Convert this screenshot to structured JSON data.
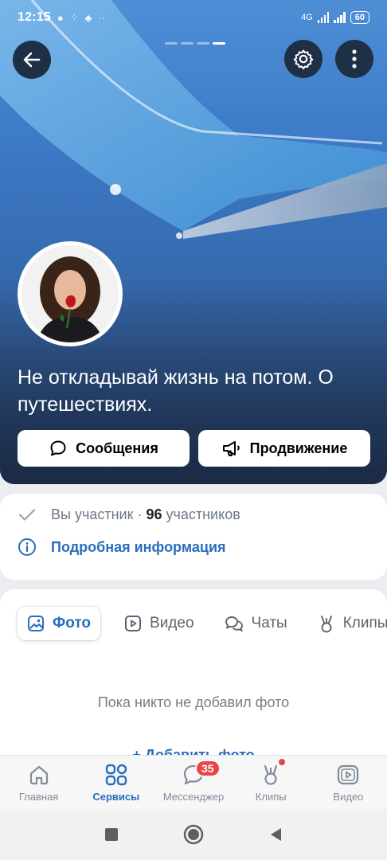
{
  "status": {
    "time": "12:15",
    "network": "4G",
    "battery": "60"
  },
  "hero": {
    "title": "Не откладывай жизнь на потом. О путешествиях.",
    "pages": 4,
    "active_page": 4
  },
  "actions": [
    {
      "label": "Сообщения",
      "icon": "chat-bubble-icon"
    },
    {
      "label": "Продвижение",
      "icon": "megaphone-icon"
    }
  ],
  "info": {
    "member_text": "Вы участник · ",
    "member_count": "96",
    "member_suffix": " участников",
    "details_link": "Подробная информация"
  },
  "tabs": [
    {
      "label": "Фото",
      "active": true
    },
    {
      "label": "Видео",
      "active": false
    },
    {
      "label": "Чаты",
      "active": false
    },
    {
      "label": "Клипы",
      "active": false
    }
  ],
  "content": {
    "empty_text": "Пока никто не добавил фото",
    "add_label": "Добавить фото"
  },
  "bottom_nav": [
    {
      "label": "Главная",
      "active": false
    },
    {
      "label": "Сервисы",
      "active": true
    },
    {
      "label": "Мессенджер",
      "active": false,
      "badge": "35"
    },
    {
      "label": "Клипы",
      "active": false,
      "dot": true
    },
    {
      "label": "Видео",
      "active": false
    }
  ],
  "colors": {
    "accent": "#2a6dbb",
    "badge": "#e64646",
    "hero_sky": "#3c79c6"
  }
}
